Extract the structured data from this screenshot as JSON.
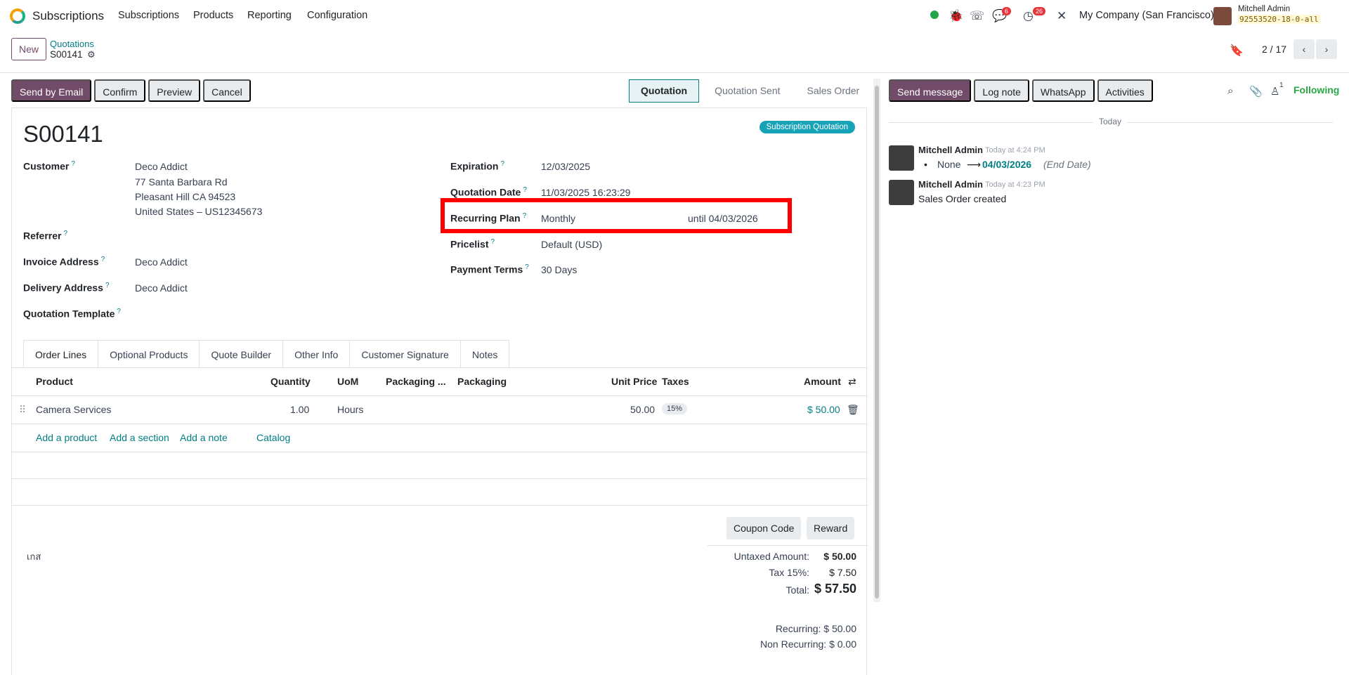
{
  "navbar": {
    "app_name": "Subscriptions",
    "menus": [
      "Subscriptions",
      "Products",
      "Reporting",
      "Configuration"
    ],
    "chat_count": "6",
    "activity_count": "26",
    "company": "My Company (San Francisco)",
    "user_name": "Mitchell Admin",
    "db_name": "92553520-18-0-all"
  },
  "control": {
    "new_label": "New",
    "breadcrumb_parent": "Quotations",
    "breadcrumb_current": "S00141",
    "pager": "2 / 17"
  },
  "actions": [
    "Send by Email",
    "Confirm",
    "Preview",
    "Cancel"
  ],
  "statusbar": [
    "Quotation",
    "Quotation Sent",
    "Sales Order"
  ],
  "record": {
    "name": "S00141",
    "badge": "Subscription Quotation",
    "customer_label": "Customer",
    "customer_name": "Deco Addict",
    "customer_street": "77 Santa Barbara Rd",
    "customer_city": "Pleasant Hill CA 94523",
    "customer_country": "United States – US12345673",
    "referrer_label": "Referrer",
    "invoice_label": "Invoice Address",
    "invoice_value": "Deco Addict",
    "delivery_label": "Delivery Address",
    "delivery_value": "Deco Addict",
    "template_label": "Quotation Template",
    "expiration_label": "Expiration",
    "expiration_value": "12/03/2025",
    "qdate_label": "Quotation Date",
    "qdate_value": "11/03/2025 16:23:29",
    "plan_label": "Recurring Plan",
    "plan_value": "Monthly",
    "plan_until": "until 04/03/2026",
    "pricelist_label": "Pricelist",
    "pricelist_value": "Default (USD)",
    "terms_label": "Payment Terms",
    "terms_value": "30 Days",
    "help_mark": "?"
  },
  "tabs": [
    "Order Lines",
    "Optional Products",
    "Quote Builder",
    "Other Info",
    "Customer Signature",
    "Notes"
  ],
  "order_lines": {
    "headers": [
      "Product",
      "Quantity",
      "UoM",
      "Packaging ...",
      "Packaging",
      "Unit Price",
      "Taxes",
      "Amount"
    ],
    "rows": [
      {
        "product": "Camera Services",
        "quantity": "1.00",
        "uom": "Hours",
        "unit_price": "50.00",
        "tax": "15%",
        "amount": "$ 50.00"
      }
    ],
    "add_links": [
      "Add a product",
      "Add a section",
      "Add a note",
      "Catalog"
    ]
  },
  "totals": {
    "note": "เกส",
    "coupon_label": "Coupon Code",
    "reward_label": "Reward",
    "untaxed_label": "Untaxed Amount:",
    "untaxed_value": "$ 50.00",
    "tax_label": "Tax 15%:",
    "tax_value": "$ 7.50",
    "total_label": "Total:",
    "total_value": "$ 57.50",
    "recurring": "Recurring: $ 50.00",
    "non_recurring": "Non Recurring: $ 0.00"
  },
  "chatter": {
    "buttons": [
      "Send message",
      "Log note",
      "WhatsApp",
      "Activities"
    ],
    "follower_count": "1",
    "following_label": "Following",
    "today_label": "Today",
    "messages": [
      {
        "author": "Mitchell Admin",
        "time": "Today at 4:24 PM",
        "old": "None",
        "new": "04/03/2026",
        "field": "(End Date)"
      },
      {
        "author": "Mitchell Admin",
        "time": "Today at 4:23 PM",
        "body": "Sales Order created"
      }
    ]
  },
  "colors": {
    "brand": "#714b67",
    "link": "#017e84",
    "highlight": "#ff0000"
  }
}
